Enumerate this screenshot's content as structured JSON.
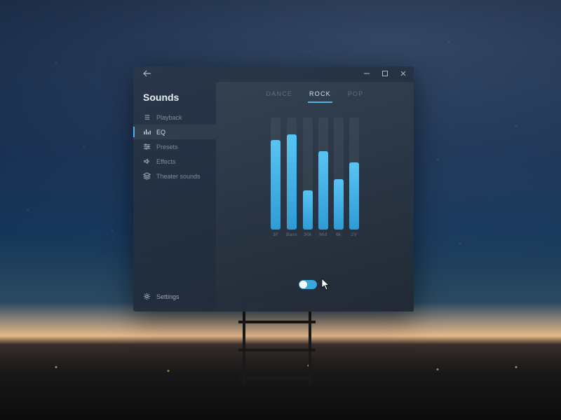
{
  "sidebar": {
    "title": "Sounds",
    "items": [
      {
        "label": "Playback",
        "icon": "list"
      },
      {
        "label": "EQ",
        "icon": "bars"
      },
      {
        "label": "Presets",
        "icon": "sliders"
      },
      {
        "label": "Effects",
        "icon": "speaker"
      },
      {
        "label": "Theater sounds",
        "icon": "layers"
      }
    ],
    "active_index": 1,
    "settings_label": "Settings"
  },
  "tabs": {
    "items": [
      "DANCE",
      "ROCK",
      "POP"
    ],
    "active_index": 1
  },
  "chart_data": {
    "type": "bar",
    "title": "",
    "xlabel": "",
    "ylabel": "",
    "ylim": [
      0,
      100
    ],
    "categories": [
      "3F",
      "Bass",
      "30k",
      "Mid",
      "6k",
      "2V"
    ],
    "values": [
      80,
      85,
      35,
      70,
      45,
      60
    ]
  },
  "toggle": {
    "state": "on"
  },
  "colors": {
    "accent": "#4fb3e8",
    "bar_top": "#59c4f2",
    "bar_bottom": "#2f9bd6"
  }
}
